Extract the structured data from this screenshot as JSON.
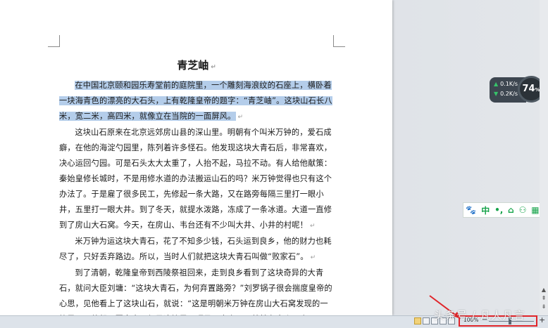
{
  "document": {
    "title": "青芝岫",
    "paragraphs": [
      {
        "text": "在中国北京颐和园乐寿堂前的庭院里，一个雕刻海浪纹的石座上，横卧着一块海青色的漂亮的大石头，上有乾隆皇帝的题字：“青芝岫”。这块山石长八米，宽二米，高四米，就像立在当院的一面屏风。",
        "selected": true
      },
      {
        "text": "这块山石原来在北京远郊房山县的深山里。明朝有个叫米万钟的，爱石成癖，在他的海淀勺园里，陈列着许多怪石。他发现这块大青石后，非常喜欢，决心运回勺园。可是石头太大太重了，人抬不起，马拉不动。有人给他献策：秦始皇修长城时，不是用修水道的办法搬运山石的吗？米万钟觉得也只有这个办法了。于是雇了很多民工，先修起一条大路，又在路旁每隔三里打一眼小井，五里打一眼大井。到了冬天，就提水泼路，冻成了一条冰道。大道一直修到了房山大石窝。今天，在房山、韦台还有不少叫大井、小井的村呢！",
        "selected": false
      },
      {
        "text": "米万钟为运这块大青石，花了不知多少钱，石头运到良乡，他的财力也耗尽了，只好丢弃路边。所以，当时人们就把这块大青石叫做“败家石”。",
        "selected": false
      },
      {
        "text": "到了清朝，乾隆皇帝到西陵祭祖回来，走到良乡看到了这块奇异的大青石，就问大臣刘墉：“这块大青石，为何弃置路旁？”刘罗锅子很会揣度皇帝的心思，见他看上了这块山石，就说：“这是明朝米万钟在房山大石窝发现的一块灵石，他想运回家去，但是这块灵石硬是不肯走了，就躺在良乡不走了。”",
        "selected": false
      }
    ],
    "paragraph_mark": "↵"
  },
  "speed_widget": {
    "upload": "0.1K/s",
    "download": "0.2K/s",
    "percent": "74",
    "percent_suffix": "%"
  },
  "ime_toolbar": {
    "items": [
      {
        "name": "paw-icon",
        "glyph": "🐾"
      },
      {
        "name": "lang-chinese",
        "glyph": "中"
      },
      {
        "name": "punctuation-icon",
        "glyph": "•,"
      },
      {
        "name": "toolbox-icon",
        "glyph": "⌂"
      },
      {
        "name": "user-icon",
        "glyph": "⚇"
      },
      {
        "name": "grid-icon",
        "glyph": "▦"
      }
    ]
  },
  "statusbar": {
    "zoom_label": "100%",
    "zoom_minus": "−",
    "zoom_plus": "+",
    "zoom_level": 1.0
  },
  "watermark": "头条号 / 凡人凡言",
  "colors": {
    "selection": "#b4cdea",
    "highlight_box": "#e0252a",
    "ime_green": "#16a34a"
  }
}
